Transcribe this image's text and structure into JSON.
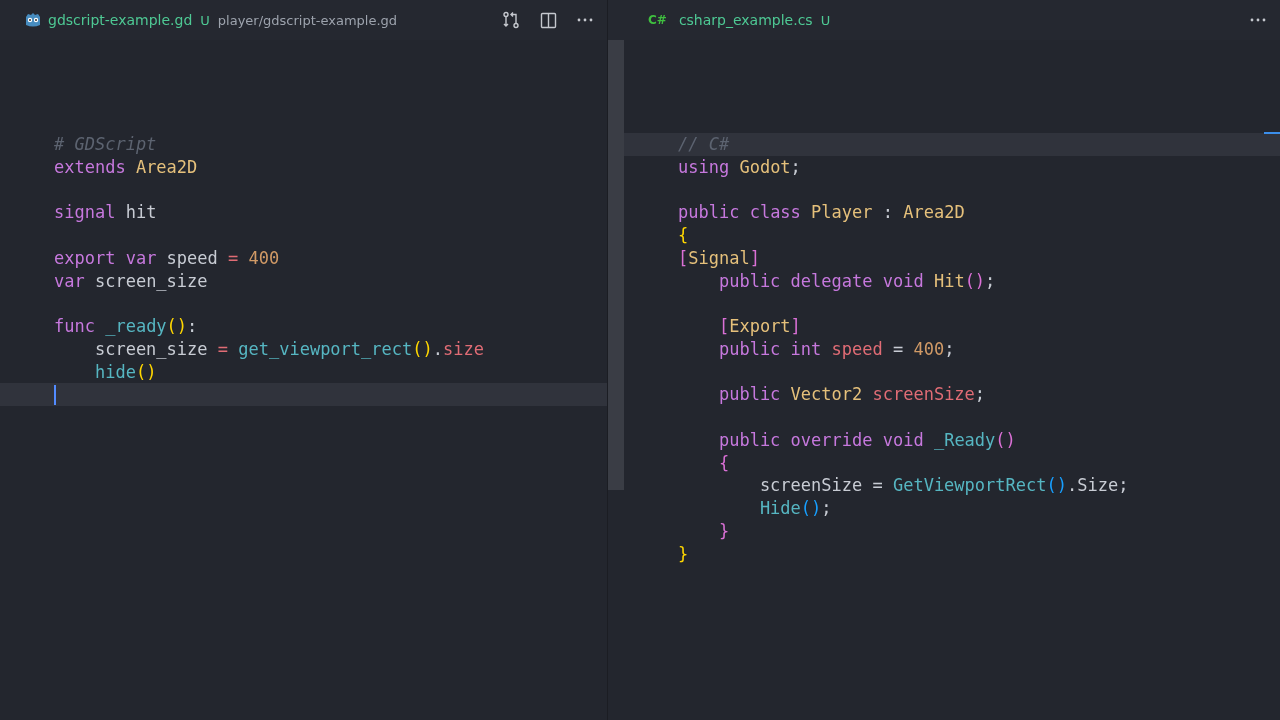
{
  "panes": [
    {
      "tab": {
        "file": "gdscript-example.gd",
        "status": "U",
        "path": "player/gdscript-example.gd"
      },
      "lines": [
        {
          "kind": "code",
          "tokens": [
            {
              "text": "# GDScript",
              "kind": "comment"
            }
          ]
        },
        {
          "kind": "code",
          "tokens": [
            {
              "text": "extends",
              "kind": "kw"
            },
            {
              "text": " Area2D",
              "kind": "type"
            }
          ]
        },
        {
          "kind": "blank"
        },
        {
          "kind": "code",
          "tokens": [
            {
              "text": "signal",
              "kind": "kw"
            },
            {
              "text": " hit",
              "kind": "plain"
            }
          ]
        },
        {
          "kind": "blank"
        },
        {
          "kind": "code",
          "tokens": [
            {
              "text": "export",
              "kind": "kw"
            },
            {
              "text": " var",
              "kind": "kw"
            },
            {
              "text": " speed",
              "kind": "plain"
            },
            {
              "text": " =",
              "kind": "op"
            },
            {
              "text": " 400",
              "kind": "num"
            }
          ]
        },
        {
          "kind": "code",
          "tokens": [
            {
              "text": "var",
              "kind": "kw"
            },
            {
              "text": " screen_size",
              "kind": "plain"
            }
          ]
        },
        {
          "kind": "blank"
        },
        {
          "kind": "code",
          "tokens": [
            {
              "text": "func",
              "kind": "kw"
            },
            {
              "text": " _ready",
              "kind": "fn"
            },
            {
              "text": "()",
              "kind": "b1"
            },
            {
              "text": ":",
              "kind": "plain"
            }
          ]
        },
        {
          "kind": "code",
          "tokens": [
            {
              "text": "    screen_size",
              "kind": "plain"
            },
            {
              "text": " =",
              "kind": "op"
            },
            {
              "text": " get_viewport_rect",
              "kind": "fn"
            },
            {
              "text": "()",
              "kind": "b1"
            },
            {
              "text": ".",
              "kind": "plain"
            },
            {
              "text": "size",
              "kind": "prop"
            }
          ]
        },
        {
          "kind": "code",
          "tokens": [
            {
              "text": "    hide",
              "kind": "fn"
            },
            {
              "text": "()",
              "kind": "b1"
            }
          ]
        },
        {
          "kind": "cursor"
        }
      ]
    },
    {
      "tab": {
        "icon_text": "C#",
        "file": "csharp_example.cs",
        "status": "U"
      },
      "lines": [
        {
          "kind": "active",
          "tokens": [
            {
              "text": "// C#",
              "kind": "comment"
            }
          ]
        },
        {
          "kind": "code",
          "tokens": [
            {
              "text": "using",
              "kind": "kw"
            },
            {
              "text": " Godot",
              "kind": "type"
            },
            {
              "text": ";",
              "kind": "plain"
            }
          ]
        },
        {
          "kind": "blank"
        },
        {
          "kind": "code",
          "tokens": [
            {
              "text": "public",
              "kind": "kw"
            },
            {
              "text": " class",
              "kind": "kw"
            },
            {
              "text": " Player",
              "kind": "type"
            },
            {
              "text": " :",
              "kind": "plain"
            },
            {
              "text": " Area2D",
              "kind": "type"
            }
          ]
        },
        {
          "kind": "code",
          "tokens": [
            {
              "text": "{",
              "kind": "b1"
            }
          ]
        },
        {
          "kind": "code",
          "tokens": [
            {
              "text": "[",
              "kind": "b2"
            },
            {
              "text": "Signal",
              "kind": "type"
            },
            {
              "text": "]",
              "kind": "b2"
            }
          ]
        },
        {
          "kind": "code",
          "tokens": [
            {
              "text": "    public",
              "kind": "kw"
            },
            {
              "text": " delegate",
              "kind": "kw"
            },
            {
              "text": " void",
              "kind": "kw"
            },
            {
              "text": " Hit",
              "kind": "type"
            },
            {
              "text": "()",
              "kind": "b2"
            },
            {
              "text": ";",
              "kind": "plain"
            }
          ]
        },
        {
          "kind": "blank"
        },
        {
          "kind": "code",
          "tokens": [
            {
              "text": "    [",
              "kind": "b2"
            },
            {
              "text": "Export",
              "kind": "type"
            },
            {
              "text": "]",
              "kind": "b2"
            }
          ]
        },
        {
          "kind": "code",
          "tokens": [
            {
              "text": "    public",
              "kind": "kw"
            },
            {
              "text": " int",
              "kind": "kw"
            },
            {
              "text": " speed",
              "kind": "prop"
            },
            {
              "text": " =",
              "kind": "plain"
            },
            {
              "text": " 400",
              "kind": "num"
            },
            {
              "text": ";",
              "kind": "plain"
            }
          ]
        },
        {
          "kind": "blank"
        },
        {
          "kind": "code",
          "tokens": [
            {
              "text": "    public",
              "kind": "kw"
            },
            {
              "text": " Vector2",
              "kind": "type"
            },
            {
              "text": " screenSize",
              "kind": "prop"
            },
            {
              "text": ";",
              "kind": "plain"
            }
          ]
        },
        {
          "kind": "blank"
        },
        {
          "kind": "code",
          "tokens": [
            {
              "text": "    public",
              "kind": "kw"
            },
            {
              "text": " override",
              "kind": "kw"
            },
            {
              "text": " void",
              "kind": "kw"
            },
            {
              "text": " _Ready",
              "kind": "fn"
            },
            {
              "text": "()",
              "kind": "b2"
            }
          ]
        },
        {
          "kind": "code",
          "tokens": [
            {
              "text": "    {",
              "kind": "b2"
            }
          ]
        },
        {
          "kind": "code",
          "tokens": [
            {
              "text": "        screenSize =",
              "kind": "plain"
            },
            {
              "text": " GetViewportRect",
              "kind": "fn"
            },
            {
              "text": "()",
              "kind": "b3"
            },
            {
              "text": ".Size;",
              "kind": "plain"
            }
          ]
        },
        {
          "kind": "code",
          "tokens": [
            {
              "text": "        Hide",
              "kind": "fn"
            },
            {
              "text": "()",
              "kind": "b3"
            },
            {
              "text": ";",
              "kind": "plain"
            }
          ]
        },
        {
          "kind": "code",
          "tokens": [
            {
              "text": "    }",
              "kind": "b2"
            }
          ]
        },
        {
          "kind": "code",
          "tokens": [
            {
              "text": "}",
              "kind": "b1"
            }
          ]
        }
      ]
    }
  ]
}
